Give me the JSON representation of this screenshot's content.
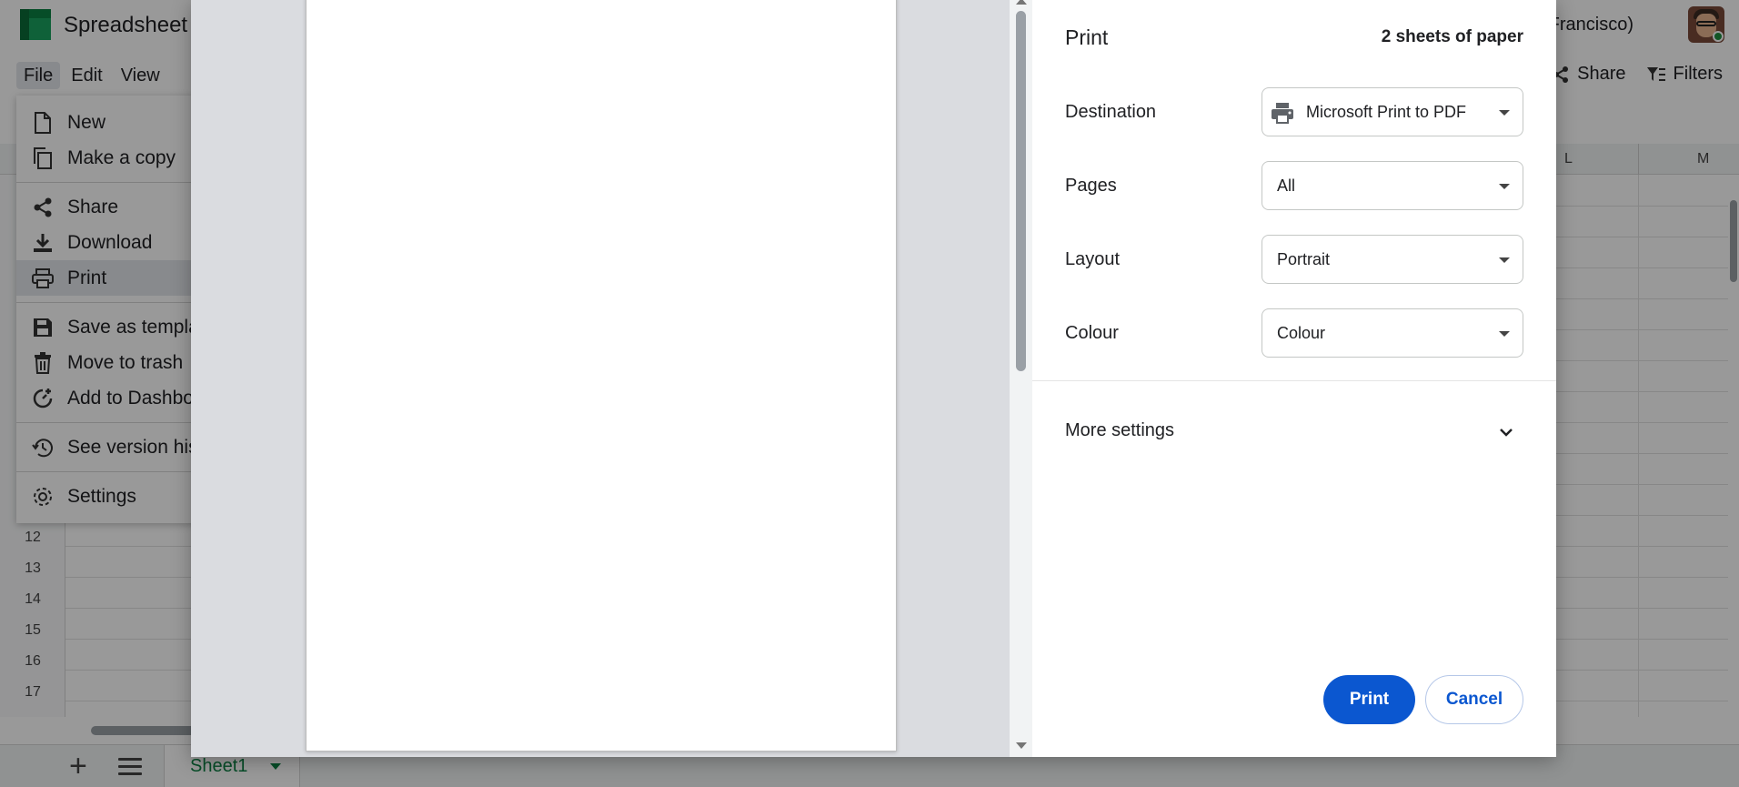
{
  "app": {
    "title": "Spreadsheet",
    "timezone_text": "an Francisco)",
    "menu": [
      "File",
      "Edit",
      "View"
    ],
    "toolbar": {
      "share": "Share",
      "filters": "Filters"
    },
    "columns": {
      "l": "L",
      "m": "M"
    },
    "rows": [
      "12",
      "13",
      "14",
      "15",
      "16",
      "17"
    ],
    "sheet_tab": "Sheet1"
  },
  "file_menu": {
    "items": [
      {
        "label": "New",
        "icon": "file-icon"
      },
      {
        "label": "Make a copy",
        "icon": "copy-icon"
      },
      {
        "label": "Share",
        "icon": "share-icon"
      },
      {
        "label": "Download",
        "icon": "download-icon"
      },
      {
        "label": "Print",
        "icon": "printer-icon"
      },
      {
        "label": "Save as templa",
        "icon": "save-icon"
      },
      {
        "label": "Move to trash",
        "icon": "trash-icon"
      },
      {
        "label": "Add to Dashbo",
        "icon": "dashboard-add-icon"
      },
      {
        "label": "See version his",
        "icon": "history-icon"
      },
      {
        "label": "Settings",
        "icon": "gear-icon"
      }
    ]
  },
  "print_dialog": {
    "title": "Print",
    "sheets_count": "2 sheets of paper",
    "destination": {
      "label": "Destination",
      "value": "Microsoft Print to PDF"
    },
    "pages": {
      "label": "Pages",
      "value": "All"
    },
    "layout": {
      "label": "Layout",
      "value": "Portrait"
    },
    "colour": {
      "label": "Colour",
      "value": "Colour"
    },
    "more_settings": "More settings",
    "print_button": "Print",
    "cancel_button": "Cancel"
  }
}
